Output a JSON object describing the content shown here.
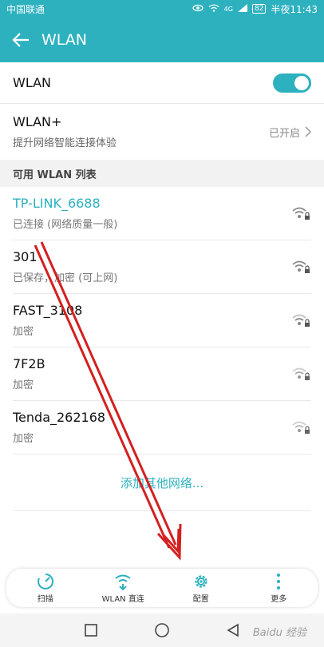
{
  "status_bar": {
    "carrier": "中国联通",
    "network": "4G",
    "battery": "82",
    "time": "半夜11:43"
  },
  "app_bar": {
    "title": "WLAN"
  },
  "wlan_toggle": {
    "label": "WLAN",
    "on": true
  },
  "wlan_plus": {
    "title": "WLAN+",
    "subtitle": "提升网络智能连接体验",
    "state": "已开启"
  },
  "list_header": "可用 WLAN 列表",
  "networks": [
    {
      "name": "TP-LINK_6688",
      "status": "已连接 (网络质量一般)",
      "connected": true
    },
    {
      "name": "301",
      "status": "已保存，加密 (可上网)",
      "connected": false
    },
    {
      "name": "FAST_3108",
      "status": "加密",
      "connected": false
    },
    {
      "name": "7F2B",
      "status": "加密",
      "connected": false
    },
    {
      "name": "Tenda_262168",
      "status": "加密",
      "connected": false
    }
  ],
  "add_network": "添加其他网络...",
  "bottom_bar": {
    "scan": "扫描",
    "direct": "WLAN 直连",
    "config": "配置",
    "more": "更多"
  },
  "watermark": "Baidu 经验",
  "colors": {
    "accent": "#2db1bf",
    "annotation_arrow": "#d42020"
  }
}
